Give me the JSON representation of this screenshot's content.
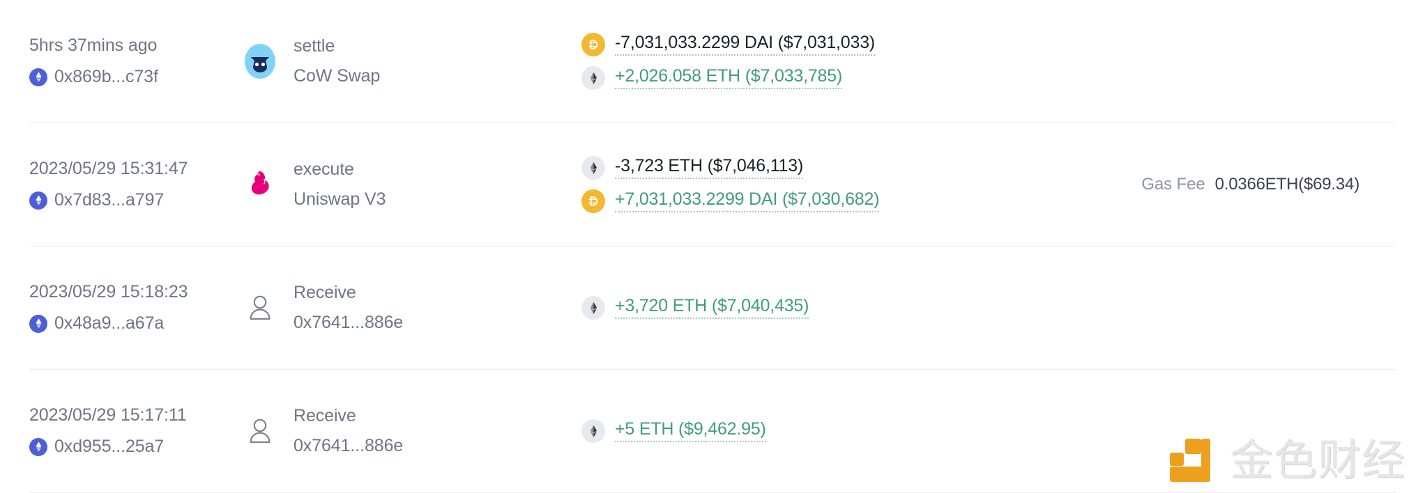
{
  "table": {
    "rows": [
      {
        "time": "5hrs 37mins ago",
        "hash": "0x869b...c73f",
        "hash_icon": "ethereum-badge-icon",
        "action": "settle",
        "protocol": "CoW Swap",
        "protocol_icon": "cow-swap-icon",
        "amounts": [
          {
            "token_icon": "dai-icon",
            "text": "-7,031,033.2299 DAI ($7,031,033)",
            "sign": "negative"
          },
          {
            "token_icon": "ethereum-icon",
            "text": "+2,026.058 ETH ($7,033,785)",
            "sign": "positive"
          }
        ],
        "gas_label": "",
        "gas_value": "",
        "has_gas": false
      },
      {
        "time": "2023/05/29 15:31:47",
        "hash": "0x7d83...a797",
        "hash_icon": "ethereum-badge-icon",
        "action": "execute",
        "protocol": "Uniswap V3",
        "protocol_icon": "uniswap-unicorn-icon",
        "amounts": [
          {
            "token_icon": "ethereum-icon",
            "text": "-3,723 ETH ($7,046,113)",
            "sign": "negative"
          },
          {
            "token_icon": "dai-icon",
            "text": "+7,031,033.2299 DAI ($7,030,682)",
            "sign": "positive"
          }
        ],
        "gas_label": "Gas Fee",
        "gas_value": "0.0366ETH($69.34)",
        "has_gas": true
      },
      {
        "time": "2023/05/29 15:18:23",
        "hash": "0x48a9...a67a",
        "hash_icon": "ethereum-badge-icon",
        "action": "Receive",
        "protocol": "0x7641...886e",
        "protocol_icon": "user-avatar-icon",
        "amounts": [
          {
            "token_icon": "ethereum-icon",
            "text": "+3,720 ETH ($7,040,435)",
            "sign": "positive"
          }
        ],
        "gas_label": "",
        "gas_value": "",
        "has_gas": false
      },
      {
        "time": "2023/05/29 15:17:11",
        "hash": "0xd955...25a7",
        "hash_icon": "ethereum-badge-icon",
        "action": "Receive",
        "protocol": "0x7641...886e",
        "protocol_icon": "user-avatar-icon",
        "amounts": [
          {
            "token_icon": "ethereum-icon",
            "text": "+5 ETH ($9,462.95)",
            "sign": "positive"
          }
        ],
        "gas_label": "",
        "gas_value": "",
        "has_gas": false
      }
    ]
  },
  "watermark": {
    "text": "金色财经",
    "logo_icon": "jinse-logo-icon"
  },
  "colors": {
    "positive": "#3f9e76",
    "negative": "#1b1f27",
    "muted": "#6e7585",
    "dai": "#f4b731",
    "eth_badge": "#4d5fd8",
    "uniswap": "#e6007a",
    "cow_swap_bg": "#81d2f7",
    "cow_swap_fg": "#1c2a5c",
    "watermark_orange": "#eda01e",
    "watermark_gray": "#e6e6e6",
    "row_divider": "#ececf0"
  }
}
